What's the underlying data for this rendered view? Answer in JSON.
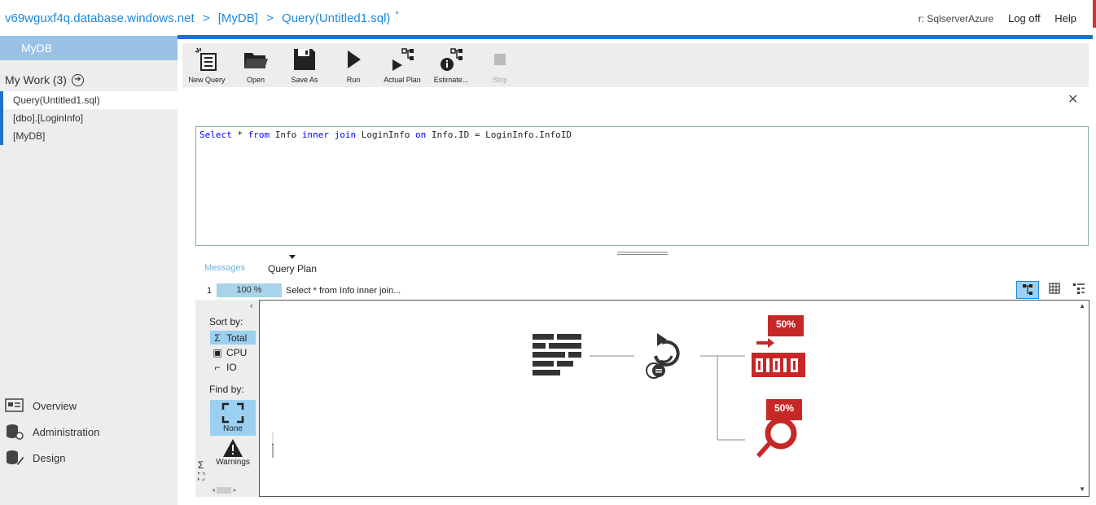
{
  "header": {
    "crumbs": [
      "v69wguxf4q.database.windows.net",
      ">",
      "[MyDB]",
      ">",
      "Query(Untitled1.sql)"
    ],
    "dirty_mark": "*",
    "server_label": "r: SqlserverAzure",
    "logoff": "Log off",
    "help": "Help"
  },
  "sidebar": {
    "db_name": "MyDB",
    "my_work": "My Work (3)",
    "items": [
      "Query(Untitled1.sql)",
      "[dbo].[LoginInfo]",
      "[MyDB]"
    ],
    "nav": [
      {
        "label": "Overview",
        "icon": "overview-icon"
      },
      {
        "label": "Administration",
        "icon": "administration-icon"
      },
      {
        "label": "Design",
        "icon": "design-icon"
      }
    ]
  },
  "toolbar": {
    "new_query": "New Query",
    "open": "Open",
    "save_as": "Save As",
    "run": "Run",
    "actual_plan": "Actual Plan",
    "estimate": "Estimate...",
    "stop": "Stop"
  },
  "editor": {
    "tokens": [
      {
        "t": "Select",
        "k": true
      },
      {
        "t": " * ",
        "k": false
      },
      {
        "t": "from",
        "k": true
      },
      {
        "t": " Info ",
        "k": false
      },
      {
        "t": "inner join",
        "k": true
      },
      {
        "t": " LoginInfo ",
        "k": false
      },
      {
        "t": "on",
        "k": true
      },
      {
        "t": " Info.ID = LoginInfo.InfoID",
        "k": false
      }
    ]
  },
  "results": {
    "tab_messages": "Messages",
    "tab_plan": "Query Plan",
    "row_number": "1",
    "row_percent": "100 %",
    "row_text": "Select * from Info inner join..."
  },
  "plan_panel": {
    "sort_by": "Sort by:",
    "sort_options": [
      "Total",
      "CPU",
      "IO"
    ],
    "find_by": "Find by:",
    "find_none": "None",
    "find_warnings": "Warnings",
    "badge_scan": "50%",
    "badge_seek": "50%"
  },
  "colors": {
    "accent": "#1e73c8",
    "selection": "#9bd0f0",
    "plan_red": "#c62828"
  }
}
